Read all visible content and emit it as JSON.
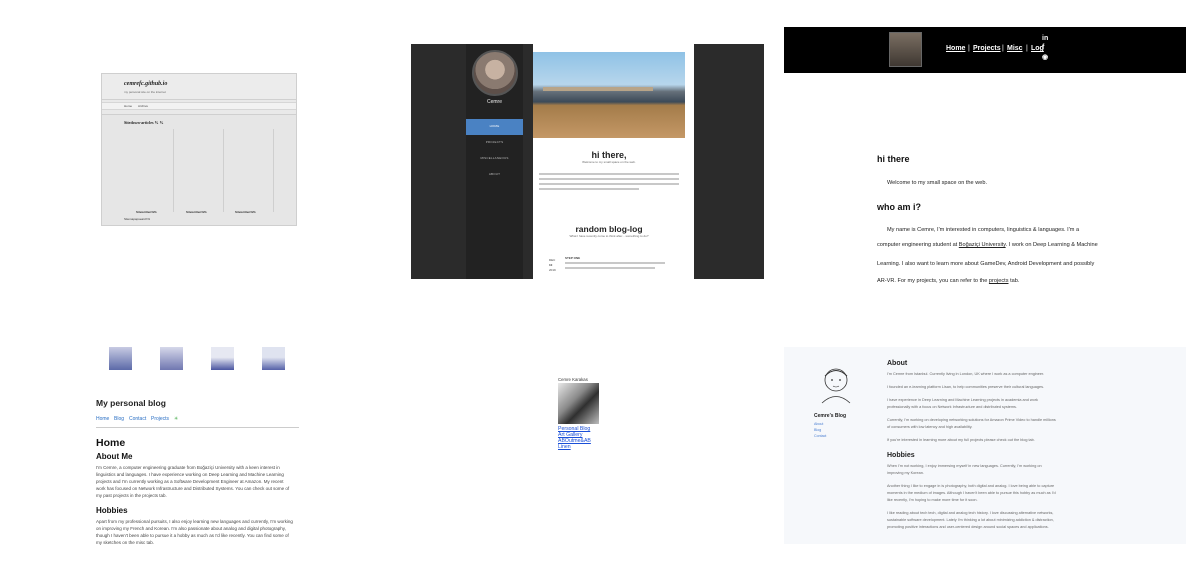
{
  "tile1": {
    "site_title": "cemrefc.github.io",
    "tagline": "my personal site on the internet",
    "nav": [
      "Home",
      "Archive"
    ],
    "section_title": "Sitedown-articles % %",
    "captions": [
      "Sitewritten%%",
      "Sitewritten%%",
      "Sitewritten%%"
    ],
    "footer": "Sitemapapsearch%"
  },
  "tile2": {
    "name": "Cemre",
    "nav": [
      "HOME",
      "PROJECTS",
      "MISCELLANEOUS",
      "ABOUT"
    ],
    "hi_title": "hi there,",
    "hi_sub": "Welcome to my small space on the web.",
    "blog_title": "random blog-log",
    "blog_sub": "What I have recently come to think after... something to do?",
    "post_title": "STEP ONE",
    "post_date": [
      "DEC",
      "10",
      "2019"
    ]
  },
  "tile3": {
    "nav": [
      "Home",
      "Projects",
      "Misc",
      "Log"
    ],
    "social": [
      "in",
      "f",
      "◉"
    ],
    "hi_heading": "hi there",
    "welcome": "Welcome to my small space on the web.",
    "who_heading": "who am i?",
    "line1": "My name is Cemre, I'm interested in computers, linguistics & languages. I'm a",
    "line2_a": "computer engineering student at ",
    "line2_link": "Boğaziçi University",
    "line2_b": ". I work on Deep Learning & Machine",
    "line3": "Learning. I also want to learn more about GameDev, Android Development and possibly",
    "line4_a": "AR-VR. For my projects, you can refer to the ",
    "line4_link": "projects",
    "line4_b": " tab."
  },
  "tile4": {
    "title": "My personal blog",
    "nav": [
      "Home",
      "Blog",
      "Contact",
      "Projects",
      "✳"
    ],
    "home": "Home",
    "about": "About Me",
    "about_lines": [
      "I'm Cemre, a computer engineering graduate from Boğaziçi University with a keen interest in",
      "linguistics and languages. I have experience working on Deep Learning and Machine Learning",
      "projects and I'm currently working as a Software Development Engineer at Amazon. My recent",
      "work has focused on Network Infrastructure and Distributed Systems. You can check out some of",
      "my past projects in the projects tab."
    ],
    "hobbies": "Hobbies",
    "hobby_lines": [
      "Apart from my professional pursuits, I also enjoy learning new languages and currently, I'm working",
      "on improving my French and Korean. I'm also passionate about analog and digital photography,",
      "though I haven't been able to pursue it a hobby as much as I'd like recently. You can find some of",
      "my sketches on the misc tab."
    ]
  },
  "tile5": {
    "name": "Cemre Karakas",
    "links": [
      "Personal Blog",
      "Art Gallery",
      "ABOutme&AB",
      "Linen"
    ]
  },
  "tile6": {
    "blog_name": "Cemre's Blog",
    "side_links": [
      "About",
      "Blog",
      "Contact"
    ],
    "about_heading": "About",
    "about_lines": [
      "I'm Cemre from Istanbul. Currently living in London, UK where I work as a computer engineer.",
      "I founded an e-learning platform Lisan, to help communities preserve their cultural languages.",
      "I have experience in Deep Learning and Machine Learning projects in academia and work",
      "professionally with a focus on Network Infrastructure and distributed systems.",
      "Currently, I'm working on developing networking solutions for Amazon Prime Video to handle millions",
      "of consumers with low latency and high availability.",
      "If you're interested in learning more about my full projects please check out the blog tab."
    ],
    "hobbies_heading": "Hobbies",
    "hobby_lines": [
      "When I'm not working, I enjoy immersing myself in new languages. Currently, I'm working on",
      "improving my Korean.",
      "Another thing I like to engage in is photography, both digital and analog. I love being able to capture",
      "moments in the medium of images. Although I haven't been able to pursue this hobby as much as I'd",
      "like recently, I'm hoping to make more time for it soon.",
      "I like reading about tech tech, digital and analog tech history. I love discussing alternative networks,",
      "sustainable software development. Lately I'm thinking a lot about minimizing addiction & distraction,",
      "promoting positive interactions and user-centered design around social spaces and applications."
    ]
  }
}
